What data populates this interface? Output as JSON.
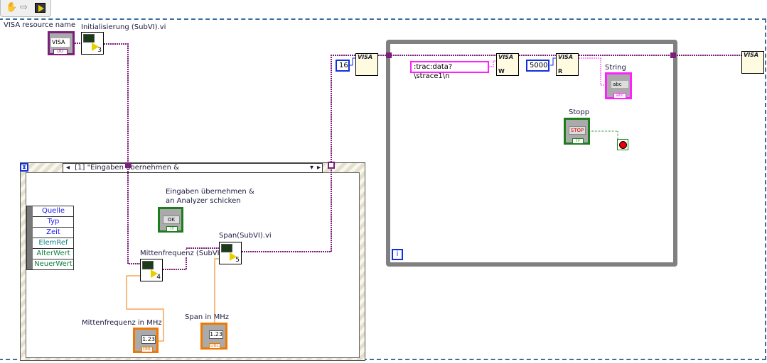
{
  "toolbar": {
    "icons": [
      "hand-icon",
      "arrow-right-icon",
      "run-vi-icon"
    ]
  },
  "colors": {
    "visa_wire": "#7a1f7a",
    "numeric_wire": "#f07800",
    "bool_wire": "#1d7d1d",
    "string_wire": "#ff20ff",
    "int_const": "#1030e0"
  },
  "visa_control": {
    "label": "VISA resource name",
    "value": "VISA",
    "tag": "I/O"
  },
  "init_subvi": {
    "label": "Initialisierung (SubVI).vi",
    "number": "3"
  },
  "event_structure": {
    "case": "[1] \"Eingaben übernehmen &",
    "event_data": [
      "Quelle",
      "Typ",
      "Zeit",
      "ElemRef",
      "AlterWert",
      "NeuerWert"
    ]
  },
  "apply_button": {
    "label_line1": "Eingaben übernehmen &",
    "label_line2": "an Analyzer schicken",
    "text": "OK",
    "tag": "TF"
  },
  "mitten_subvi": {
    "label": "Mittenfrequenz (SubVI).vi",
    "number": "4"
  },
  "span_subvi": {
    "label": "Span(SubVI).vi",
    "number": "5"
  },
  "mitten_control": {
    "label": "Mittenfrequenz in MHz",
    "value": "1.23",
    "tag": "DBL"
  },
  "span_control": {
    "label": "Span in MHz",
    "value": "1.23",
    "tag": "DBL"
  },
  "const_16": "16",
  "visa_label": "VISA",
  "command_string": ":trac:data?\\strace1\\n",
  "const_5000": "5000",
  "write_letter": "W",
  "read_letter": "R",
  "string_indicator": {
    "label": "String",
    "value": "abc",
    "tag": "abc"
  },
  "stop_control": {
    "label": "Stopp",
    "text": "STOP",
    "tag": "TF"
  },
  "iteration": "i"
}
